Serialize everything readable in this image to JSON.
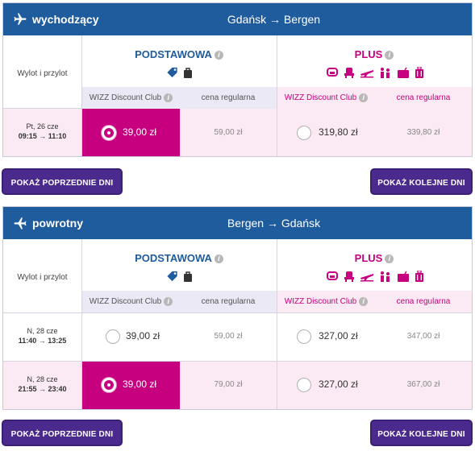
{
  "colors": {
    "header_blue": "#1f5c9e",
    "magenta": "#c6007e",
    "button_purple": "#4b2a8e",
    "lavender": "#eae9f5",
    "light_pink": "#fbe9f3"
  },
  "outbound": {
    "direction": "wychodzący",
    "route": "Gdańsk → Bergen",
    "col_label": "Wylot i przylot",
    "basic": {
      "title": "PODSTAWOWA",
      "info_icon": "i",
      "icons": [
        "tag-icon",
        "bag-icon"
      ]
    },
    "plus": {
      "title": "PLUS",
      "info_icon": "i",
      "icons": [
        "seat-icon",
        "chair-icon",
        "plane-icon",
        "people-icon",
        "suitcase-icon",
        "luggage-icon"
      ]
    },
    "sub": {
      "wdc": "WIZZ Discount Club",
      "regular": "cena regularna"
    },
    "rows": [
      {
        "date": "Pt, 26 cze",
        "time": "09:15 → 11:10",
        "basic_wdc": "39,00 zł",
        "basic_reg": "59,00 zł",
        "plus_wdc": "319,80 zł",
        "plus_reg": "339,80 zł",
        "selected": true
      }
    ],
    "prev_btn": "POKAŻ POPRZEDNIE DNI",
    "next_btn": "POKAŻ KOLEJNE DNI"
  },
  "return": {
    "direction": "powrotny",
    "route": "Bergen → Gdańsk",
    "col_label": "Wylot i przylot",
    "basic": {
      "title": "PODSTAWOWA",
      "info_icon": "i",
      "icons": [
        "tag-icon",
        "bag-icon"
      ]
    },
    "plus": {
      "title": "PLUS",
      "info_icon": "i",
      "icons": [
        "seat-icon",
        "chair-icon",
        "plane-icon",
        "people-icon",
        "suitcase-icon",
        "luggage-icon"
      ]
    },
    "sub": {
      "wdc": "WIZZ Discount Club",
      "regular": "cena regularna"
    },
    "rows": [
      {
        "date": "N, 28 cze",
        "time": "11:40 → 13:25",
        "basic_wdc": "39,00 zł",
        "basic_reg": "59,00 zł",
        "plus_wdc": "327,00 zł",
        "plus_reg": "347,00 zł",
        "selected": false
      },
      {
        "date": "N, 28 cze",
        "time": "21:55 → 23:40",
        "basic_wdc": "39,00 zł",
        "basic_reg": "79,00 zł",
        "plus_wdc": "327,00 zł",
        "plus_reg": "367,00 zł",
        "selected": true
      }
    ],
    "prev_btn": "POKAŻ POPRZEDNIE DNI",
    "next_btn": "POKAŻ KOLEJNE DNI"
  }
}
